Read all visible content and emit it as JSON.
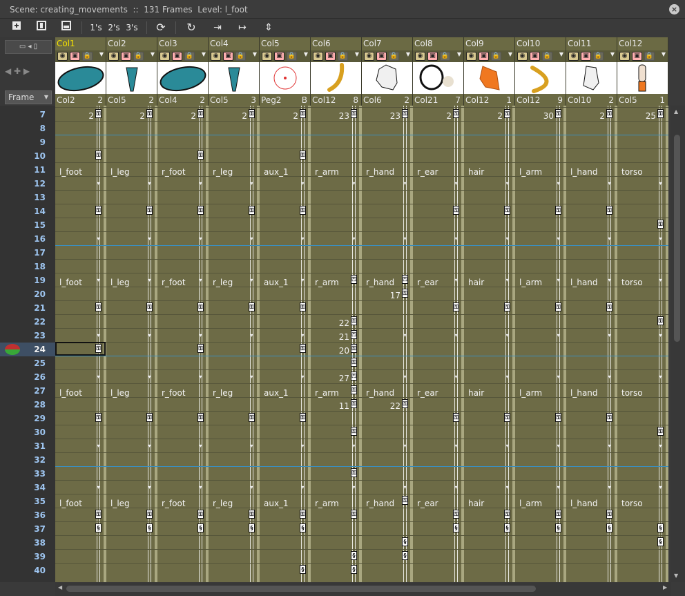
{
  "title": {
    "scene_label": "Scene: creating_movements",
    "separator": "::",
    "frames_label": "131 Frames",
    "level_label": "Level: l_foot",
    "close_icon": "close-icon"
  },
  "toolbar": {
    "icons": [
      "add-drawing-icon",
      "new-column-icon",
      "duplicate-icon"
    ],
    "step_1": "1's",
    "step_2": "2's",
    "step_3": "3's",
    "icons2": [
      "refresh-icon",
      "rotate-icon",
      "import-icon",
      "export-icon",
      "expand-icon"
    ]
  },
  "left_panel": {
    "layout_toggle": "▭ ◂ ▯",
    "nav": "◀ ✚ ▶",
    "frame_select": "Frame"
  },
  "columns": [
    {
      "name": "Col1",
      "drawing": "Col2",
      "num": "2",
      "selected": true,
      "shape": "blob-l"
    },
    {
      "name": "Col2",
      "drawing": "Col5",
      "num": "2",
      "shape": "leg"
    },
    {
      "name": "Col3",
      "drawing": "Col4",
      "num": "2",
      "shape": "blob-r"
    },
    {
      "name": "Col4",
      "drawing": "Col5",
      "num": "3",
      "shape": "leg"
    },
    {
      "name": "Col5",
      "drawing": "Peg2",
      "num": "B",
      "shape": "peg"
    },
    {
      "name": "Col6",
      "drawing": "Col12",
      "num": "8",
      "shape": "arm"
    },
    {
      "name": "Col7",
      "drawing": "Col6",
      "num": "2",
      "shape": "hand"
    },
    {
      "name": "Col8",
      "drawing": "Col21",
      "num": "7",
      "shape": "ear"
    },
    {
      "name": "Col9",
      "drawing": "Col12",
      "num": "1",
      "shape": "hair"
    },
    {
      "name": "Col10",
      "drawing": "Col12",
      "num": "9",
      "shape": "larm"
    },
    {
      "name": "Col11",
      "drawing": "Col10",
      "num": "2",
      "shape": "lhand"
    },
    {
      "name": "Col12",
      "drawing": "Col5",
      "num": "1",
      "shape": "torso"
    }
  ],
  "rows": [
    "7",
    "8",
    "9",
    "10",
    "11",
    "12",
    "13",
    "14",
    "15",
    "16",
    "17",
    "18",
    "19",
    "20",
    "21",
    "22",
    "23",
    "24",
    "25",
    "26",
    "27",
    "28",
    "29",
    "30",
    "31",
    "32",
    "33",
    "34",
    "35",
    "36",
    "37",
    "38",
    "39",
    "40"
  ],
  "current_row": "24",
  "row7_values": [
    "2",
    "2",
    "2",
    "2",
    "2",
    "23",
    "23",
    "2",
    "2",
    "30",
    "2",
    "25"
  ],
  "row_labels": [
    "l_foot",
    "l_leg",
    "r_foot",
    "r_leg",
    "aux_1",
    "r_arm",
    "r_hand",
    "r_ear",
    "hair",
    "l_arm",
    "l_hand",
    "torso"
  ],
  "extra_numbers": [
    {
      "col": 6,
      "row": "20",
      "value": "17"
    },
    {
      "col": 5,
      "row": "22",
      "value": "22"
    },
    {
      "col": 5,
      "row": "23",
      "value": "21"
    },
    {
      "col": 5,
      "row": "24",
      "value": "20"
    },
    {
      "col": 5,
      "row": "26",
      "value": "27"
    },
    {
      "col": 5,
      "row": "28",
      "value": "11"
    },
    {
      "col": 6,
      "row": "28",
      "value": "22"
    }
  ]
}
